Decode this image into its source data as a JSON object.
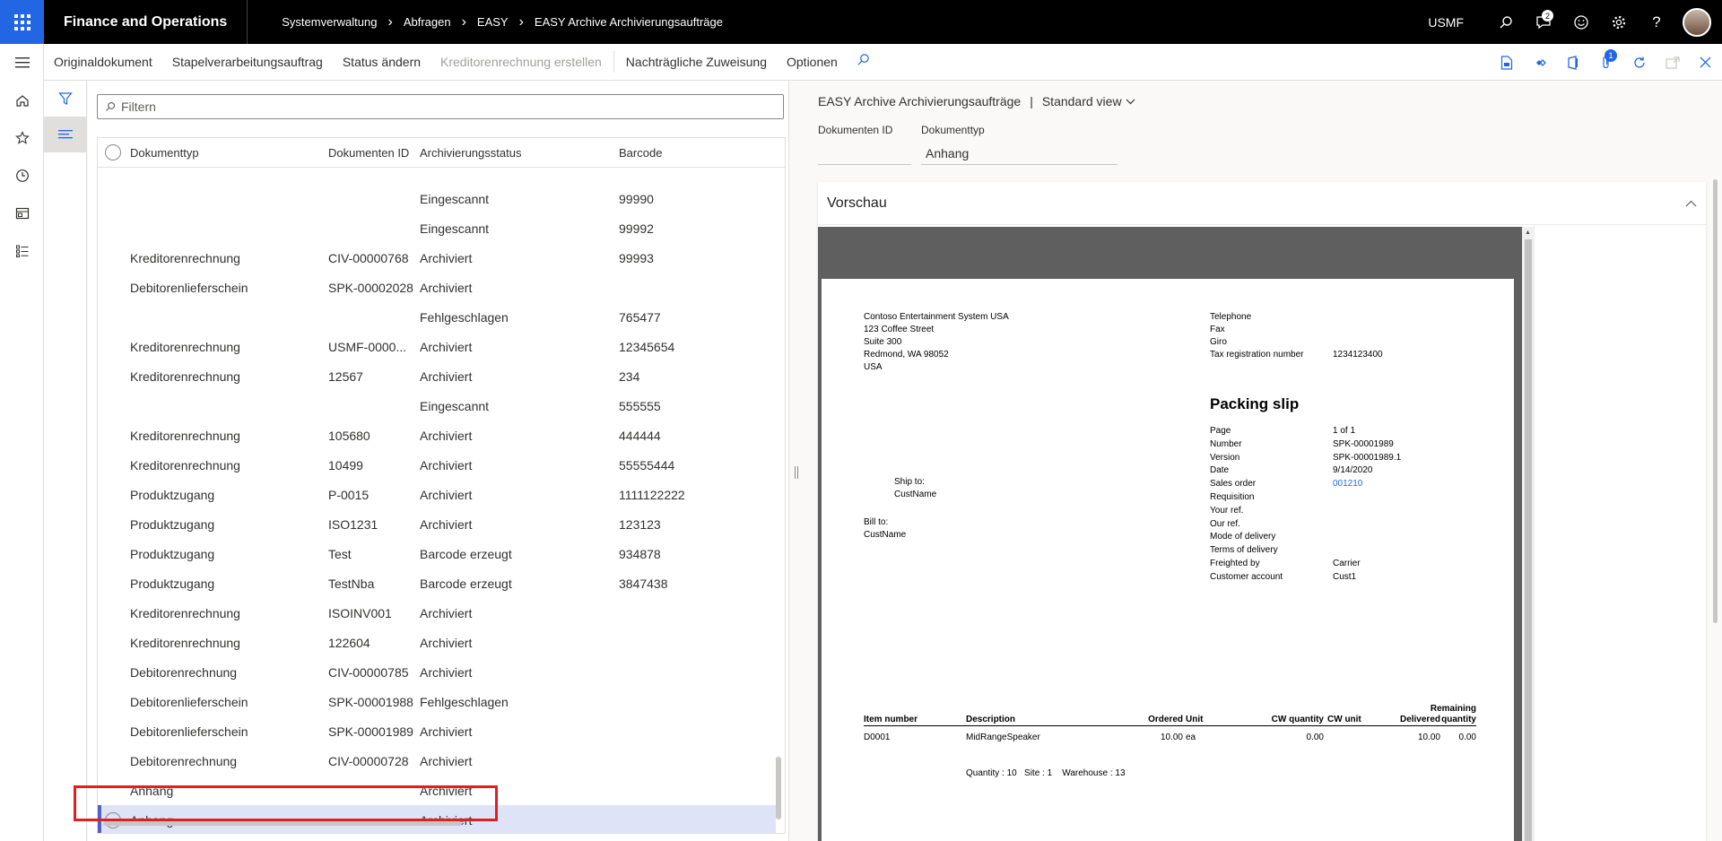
{
  "app": {
    "title": "Finance and Operations",
    "breadcrumbs": [
      "Systemverwaltung",
      "Abfragen",
      "EASY",
      "EASY Archive Archivierungsaufträge"
    ],
    "company": "USMF",
    "notification_count": "2"
  },
  "toolbar": {
    "items": [
      {
        "label": "Originaldokument",
        "enabled": true
      },
      {
        "label": "Stapelverarbeitungsauftrag",
        "enabled": true
      },
      {
        "label": "Status ändern",
        "enabled": true
      },
      {
        "label": "Kreditorenrechnung erstellen",
        "enabled": false
      },
      {
        "label": "Nachträgliche Zuweisung",
        "enabled": true
      },
      {
        "label": "Optionen",
        "enabled": true
      }
    ],
    "attachments_badge": "1"
  },
  "list": {
    "filter_placeholder": "Filtern",
    "columns": [
      "Dokumenttyp",
      "Dokumenten ID",
      "Archivierungsstatus",
      "Barcode"
    ],
    "rows": [
      {
        "type": "",
        "id": "",
        "status": "Eingescannt",
        "barcode": "99990"
      },
      {
        "type": "",
        "id": "",
        "status": "Eingescannt",
        "barcode": "99992"
      },
      {
        "type": "Kreditorenrechnung",
        "id": "CIV-00000768",
        "status": "Archiviert",
        "barcode": "99993"
      },
      {
        "type": "Debitorenlieferschein",
        "id": "SPK-00002028",
        "status": "Archiviert",
        "barcode": ""
      },
      {
        "type": "",
        "id": "",
        "status": "Fehlgeschlagen",
        "barcode": "765477"
      },
      {
        "type": "Kreditorenrechnung",
        "id": "USMF-0000...",
        "status": "Archiviert",
        "barcode": "12345654"
      },
      {
        "type": "Kreditorenrechnung",
        "id": "12567",
        "status": "Archiviert",
        "barcode": "234"
      },
      {
        "type": "",
        "id": "",
        "status": "Eingescannt",
        "barcode": "555555"
      },
      {
        "type": "Kreditorenrechnung",
        "id": "105680",
        "status": "Archiviert",
        "barcode": "444444"
      },
      {
        "type": "Kreditorenrechnung",
        "id": "10499",
        "status": "Archiviert",
        "barcode": "55555444"
      },
      {
        "type": "Produktzugang",
        "id": "P-0015",
        "status": "Archiviert",
        "barcode": "1111122222"
      },
      {
        "type": "Produktzugang",
        "id": "ISO1231",
        "status": "Archiviert",
        "barcode": "123123"
      },
      {
        "type": "Produktzugang",
        "id": "Test",
        "status": "Barcode erzeugt",
        "barcode": "934878"
      },
      {
        "type": "Produktzugang",
        "id": "TestNba",
        "status": "Barcode erzeugt",
        "barcode": "3847438"
      },
      {
        "type": "Kreditorenrechnung",
        "id": "ISOINV001",
        "status": "Archiviert",
        "barcode": ""
      },
      {
        "type": "Kreditorenrechnung",
        "id": "122604",
        "status": "Archiviert",
        "barcode": ""
      },
      {
        "type": "Debitorenrechnung",
        "id": "CIV-00000785",
        "status": "Archiviert",
        "barcode": ""
      },
      {
        "type": "Debitorenlieferschein",
        "id": "SPK-00001988",
        "status": "Fehlgeschlagen",
        "barcode": ""
      },
      {
        "type": "Debitorenlieferschein",
        "id": "SPK-00001989",
        "status": "Archiviert",
        "barcode": ""
      },
      {
        "type": "Debitorenrechnung",
        "id": "CIV-00000728",
        "status": "Archiviert",
        "barcode": ""
      },
      {
        "type": "Anhang",
        "id": "",
        "status": "Archiviert",
        "barcode": ""
      },
      {
        "type": "Anhang",
        "id": "",
        "status": "Archiviert",
        "barcode": "",
        "selected": true
      }
    ]
  },
  "detail": {
    "title": "EASY Archive Archivierungsaufträge",
    "separator": "|",
    "view": "Standard view",
    "fields": {
      "doc_id_label": "Dokumenten ID",
      "doc_id_value": "",
      "doc_type_label": "Dokumenttyp",
      "doc_type_value": "Anhang"
    },
    "preview_title": "Vorschau"
  },
  "document": {
    "address": [
      "Contoso Entertainment System USA",
      "123 Coffee Street",
      "Suite 300",
      "Redmond, WA 98052",
      "USA"
    ],
    "contact_labels": [
      "Telephone",
      "Fax",
      "Giro",
      "Tax registration number"
    ],
    "tax_number": "1234123400",
    "title": "Packing slip",
    "meta_labels": [
      "Page",
      "Number",
      "Version",
      "Date",
      "Sales order",
      "Requisition",
      "Your ref.",
      "Our ref.",
      "Mode of delivery",
      "Terms of delivery",
      "Freighted by",
      "Customer account"
    ],
    "meta_values": {
      "page": "1  of  1",
      "number": "SPK-00001989",
      "version": "SPK-00001989.1",
      "date": "9/14/2020",
      "sales_order": "001210",
      "freighted_by": "Carrier",
      "customer_account": "Cust1"
    },
    "ship_to_label": "Ship to:",
    "ship_to_name": "CustName",
    "bill_to_label": "Bill to:",
    "bill_to_name": "CustName",
    "table_headers": {
      "item_number": "Item number",
      "description": "Description",
      "ordered": "Ordered",
      "unit": "Unit",
      "cw_quantity": "CW quantity",
      "cw_unit": "CW unit",
      "delivered": "Delivered",
      "remaining_1": "Remaining",
      "remaining_2": "quantity"
    },
    "line": {
      "item": "D0001",
      "description": "MidRangeSpeaker",
      "ordered": "10.00",
      "unit": "ea",
      "cw_quantity": "0.00",
      "delivered": "10.00",
      "remaining": "0.00"
    },
    "line_detail": "Quantity : 10   Site : 1    Warehouse : 13"
  }
}
